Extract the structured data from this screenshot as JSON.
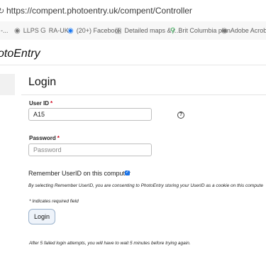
{
  "browser": {
    "url": "https://compent.photoentry.uk/compent/Controller",
    "bookmarks": [
      {
        "icon": "link-icon",
        "label": "y -..."
      },
      {
        "icon": "globe-icon",
        "label": "LLPS"
      },
      {
        "icon": "google-icon",
        "label": "RA-UK"
      },
      {
        "icon": "facebook-icon",
        "label": "(20+) Facebook"
      },
      {
        "icon": "map-icon",
        "label": "Detailed maps & r..."
      },
      {
        "icon": "location-pin-icon",
        "label": "Brit Columbia plan"
      },
      {
        "icon": "globe-icon",
        "label": "Adobe Acrobat Ho"
      }
    ]
  },
  "brand": "otoEntry",
  "login": {
    "title": "Login",
    "userid_label": "User ID",
    "userid_value": "A15",
    "password_label": "Password",
    "password_placeholder": "Password",
    "required_mark": "*",
    "remember_label": "Remember UserID on this computer",
    "consent_text": "By selecting Remember UserID, you are consenting to PhotoEntry storing your UserID as a cookie on this compute",
    "required_note": "* Indicates required field",
    "button_label": "Login",
    "attempts_note": "After 5 failed login attempts, you will have to wait 5 minutes before trying again."
  },
  "colors": {
    "accent": "#1a73e8",
    "required": "#d0021b",
    "button_bg": "#eef3fa"
  }
}
